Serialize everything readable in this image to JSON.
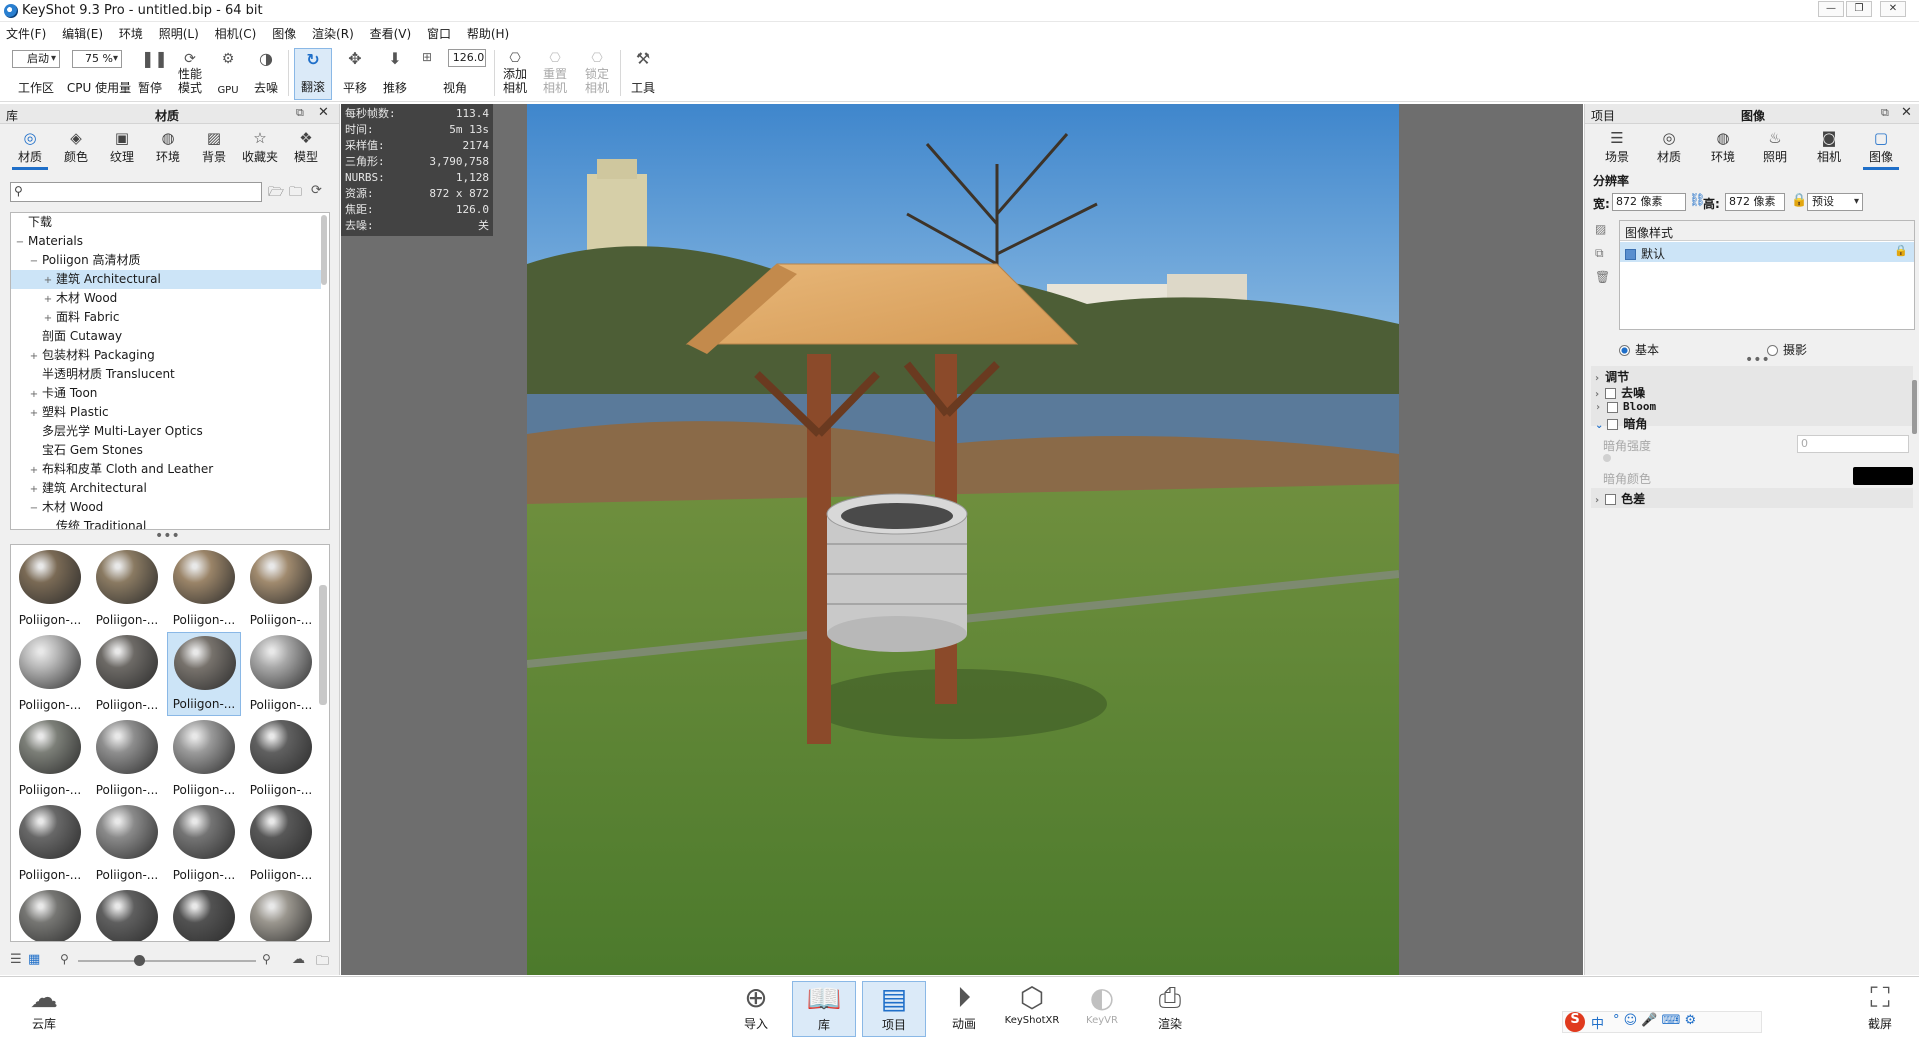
{
  "window": {
    "title": "KeyShot 9.3 Pro  - untitled.bip  - 64 bit"
  },
  "menu": [
    "文件(F)",
    "编辑(E)",
    "环境",
    "照明(L)",
    "相机(C)",
    "图像",
    "渲染(R)",
    "查看(V)",
    "窗口",
    "帮助(H)"
  ],
  "toolbar": {
    "workspace_value": "启动",
    "workspace_label": "工作区",
    "cpu_percent": "75 %",
    "cpu_label": "CPU 使用量",
    "pause_label": "暂停",
    "perf_label1": "性能",
    "perf_label2": "模式",
    "gpu_label": "GPU",
    "denoise_label": "去噪",
    "tumble_label": "翻滚",
    "pan_label": "平移",
    "dolly_label": "推移",
    "fov_value": "126.0",
    "fov_label": "视角",
    "add_camera1": "添加",
    "add_camera2": "相机",
    "reset_camera1": "重置",
    "reset_camera2": "相机",
    "lock_camera1": "锁定",
    "lock_camera2": "相机",
    "tools_label": "工具"
  },
  "library": {
    "panel_label": "库",
    "panel_title": "材质",
    "tabs": [
      "材质",
      "颜色",
      "纹理",
      "环境",
      "背景",
      "收藏夹",
      "模型"
    ],
    "tree": [
      {
        "label": "下载",
        "indent": 0,
        "exp": ""
      },
      {
        "label": "Materials",
        "indent": 0,
        "exp": "−"
      },
      {
        "label": "Poliigon 高清材质",
        "indent": 1,
        "exp": "−"
      },
      {
        "label": "建筑 Architectural",
        "indent": 2,
        "exp": "+"
      },
      {
        "label": "木材 Wood",
        "indent": 2,
        "exp": "+"
      },
      {
        "label": "面料 Fabric",
        "indent": 2,
        "exp": "+"
      },
      {
        "label": "剖面 Cutaway",
        "indent": 1,
        "exp": ""
      },
      {
        "label": "包装材料 Packaging",
        "indent": 1,
        "exp": "+"
      },
      {
        "label": "半透明材质 Translucent",
        "indent": 1,
        "exp": ""
      },
      {
        "label": "卡通 Toon",
        "indent": 1,
        "exp": "+"
      },
      {
        "label": "塑料 Plastic",
        "indent": 1,
        "exp": "+"
      },
      {
        "label": "多层光学 Multi-Layer Optics",
        "indent": 1,
        "exp": ""
      },
      {
        "label": "宝石 Gem Stones",
        "indent": 1,
        "exp": ""
      },
      {
        "label": "布料和皮革 Cloth and Leather",
        "indent": 1,
        "exp": "+"
      },
      {
        "label": "建筑 Architectural",
        "indent": 1,
        "exp": "+"
      },
      {
        "label": "木材 Wood",
        "indent": 1,
        "exp": "−"
      },
      {
        "label": "传统 Traditional",
        "indent": 2,
        "exp": ""
      }
    ],
    "thumb_label": "Poliigon-...",
    "thumb_colors": [
      "#7a6a55",
      "#8a7a62",
      "#9a8468",
      "#a08a6e",
      "#b8b8b8",
      "#6d6a66",
      "#77726c",
      "#a8a8a8",
      "#7c7f78",
      "#8e8e8e",
      "#9a9a9a",
      "#606060",
      "#686868",
      "#8a8a8a",
      "#747474",
      "#585858",
      "#767673",
      "#5f5f5f",
      "#525252",
      "#9a968e"
    ]
  },
  "stats": [
    {
      "k": "每秒帧数:",
      "v": "113.4"
    },
    {
      "k": "时间:",
      "v": "5m 13s"
    },
    {
      "k": "采样值:",
      "v": "2174"
    },
    {
      "k": "三角形:",
      "v": "3,790,758"
    },
    {
      "k": "NURBS:",
      "v": "1,128"
    },
    {
      "k": "资源:",
      "v": "872 x 872"
    },
    {
      "k": "焦距:",
      "v": "126.0"
    },
    {
      "k": "去噪:",
      "v": "关"
    }
  ],
  "project": {
    "panel_label": "项目",
    "panel_title": "图像",
    "tabs": [
      "场景",
      "材质",
      "环境",
      "照明",
      "相机",
      "图像"
    ],
    "resolution_title": "分辨率",
    "width_label": "宽:",
    "width_value": "872 像素",
    "height_label": "高:",
    "height_value": "872 像素",
    "preset_label": "预设",
    "style_header": "图像样式",
    "style_default": "默认",
    "mode_basic": "基本",
    "mode_photo": "摄影",
    "adjust_label": "调节",
    "denoise_label": "去噪",
    "bloom_label": "Bloom",
    "vignette_label": "暗角",
    "vignette_strength_label": "暗角强度",
    "vignette_strength_value": "0",
    "vignette_color_label": "暗角颜色",
    "vignette_color": "#000000",
    "chromatic_label": "色差"
  },
  "bottom": {
    "cloud_label": "云库",
    "buttons": [
      "导入",
      "库",
      "项目",
      "动画",
      "KeyShotXR",
      "KeyVR",
      "渲染"
    ],
    "screenshot_label": "截屏"
  },
  "ime": {
    "lang": "中"
  }
}
